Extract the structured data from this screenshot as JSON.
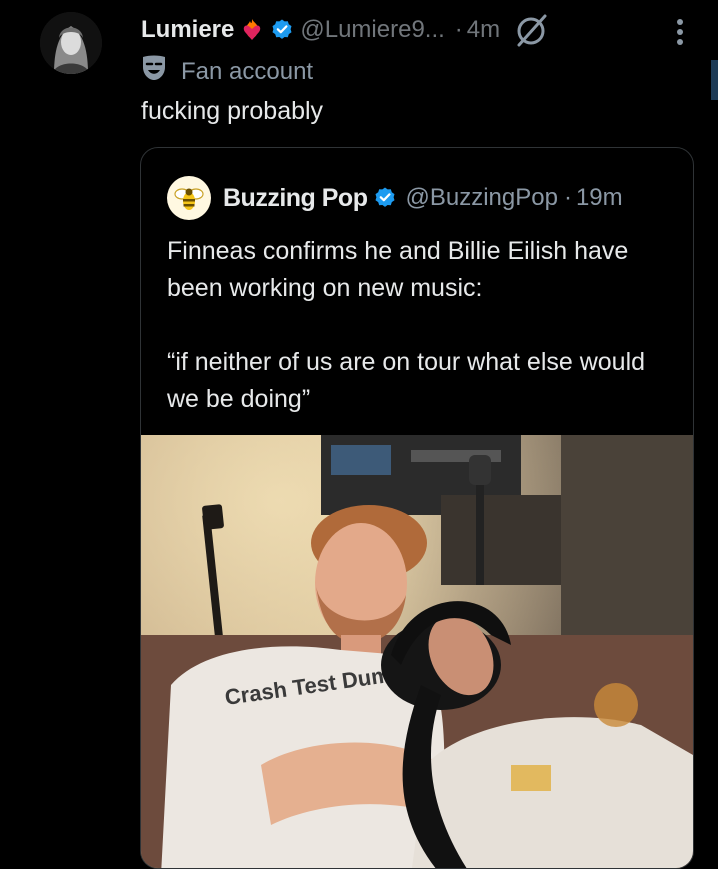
{
  "tweet": {
    "author_name": "Lumiere",
    "author_handle": "@Lumiere9...",
    "separator": "·",
    "time": "4m",
    "label": "Fan account",
    "text": "fucking probably"
  },
  "quote": {
    "author_name": "Buzzing Pop",
    "author_handle": "@BuzzingPop",
    "separator": "·",
    "time": "19m",
    "text_line1": "Finneas confirms he and Billie Eilish have been working on new music:",
    "text_line2": "“if neither of us are on tour what else would we be doing”",
    "photo_shirt_text": "Crash Test Dummies"
  },
  "colors": {
    "background": "#000000",
    "text_primary": "#e7e9ea",
    "text_secondary": "#71767b",
    "verified_blue": "#1d9bf0",
    "border": "#2f3336"
  },
  "icons": {
    "avatar": "avatar-image",
    "emoji_badge": "heart-on-fire-emoji",
    "verified": "verified-badge-icon",
    "grok": "grok-icon",
    "more": "more-vertical-icon",
    "label": "theater-mask-icon",
    "quote_avatar": "bee-logo-icon"
  }
}
